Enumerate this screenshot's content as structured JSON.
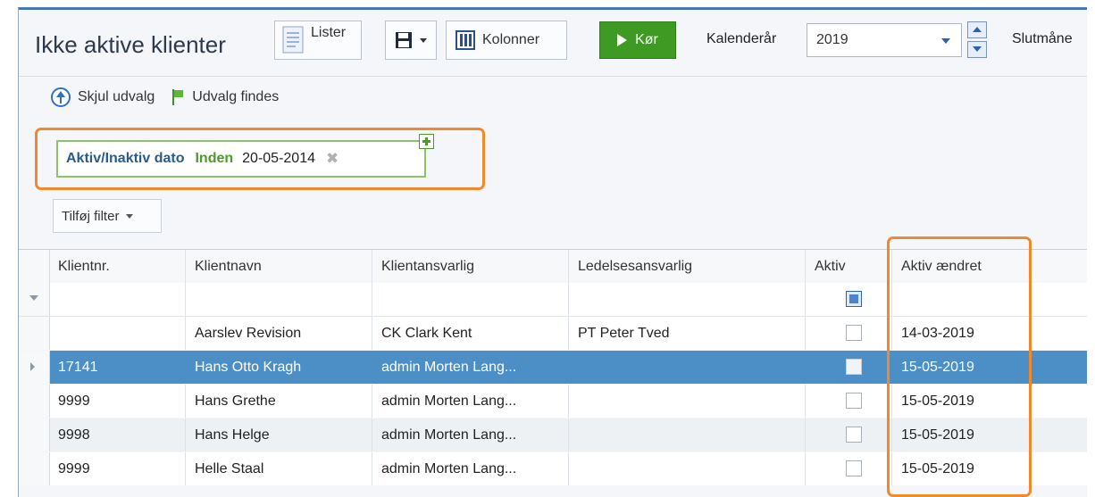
{
  "window": {
    "title": "Ikke aktive klienter"
  },
  "toolbar": {
    "lists_label": "Lister",
    "columns_label": "Kolonner",
    "run_label": "Kør",
    "calendar_year_label": "Kalenderår",
    "calendar_year_value": "2019",
    "end_month_label": "Slutmåne"
  },
  "filter_panel": {
    "hide_selection_label": "Skjul udvalg",
    "selection_exists_label": "Udvalg findes",
    "chip": {
      "field": "Aktiv/Inaktiv dato",
      "operator": "Inden",
      "value": "20-05-2014"
    },
    "add_filter_label": "Tilføj filter"
  },
  "grid": {
    "columns": [
      "Klientnr.",
      "Klientnavn",
      "Klientansvarlig",
      "Ledelsesansvarlig",
      "Aktiv",
      "Aktiv ændret"
    ],
    "rows": [
      {
        "nr": "",
        "name": "Aarslev Revision",
        "resp": "CK Clark Kent",
        "mgmt": "PT Peter Tved",
        "active": false,
        "changed": "14-03-2019"
      },
      {
        "nr": "17141",
        "name": "Hans Otto Kragh",
        "resp": "admin Morten Lang...",
        "mgmt": "",
        "active": false,
        "changed": "15-05-2019"
      },
      {
        "nr": "9999",
        "name": "Hans Grethe",
        "resp": "admin Morten Lang...",
        "mgmt": "",
        "active": false,
        "changed": "15-05-2019"
      },
      {
        "nr": "9998",
        "name": "Hans Helge",
        "resp": "admin Morten Lang...",
        "mgmt": "",
        "active": false,
        "changed": "15-05-2019"
      },
      {
        "nr": "9999",
        "name": "Helle Staal",
        "resp": "admin Morten Lang...",
        "mgmt": "",
        "active": false,
        "changed": "15-05-2019"
      }
    ]
  },
  "colors": {
    "accent": "#3a72c4",
    "run_green": "#3f9a24",
    "selection_blue": "#4c8fc6",
    "highlight_orange": "#f0892c"
  }
}
